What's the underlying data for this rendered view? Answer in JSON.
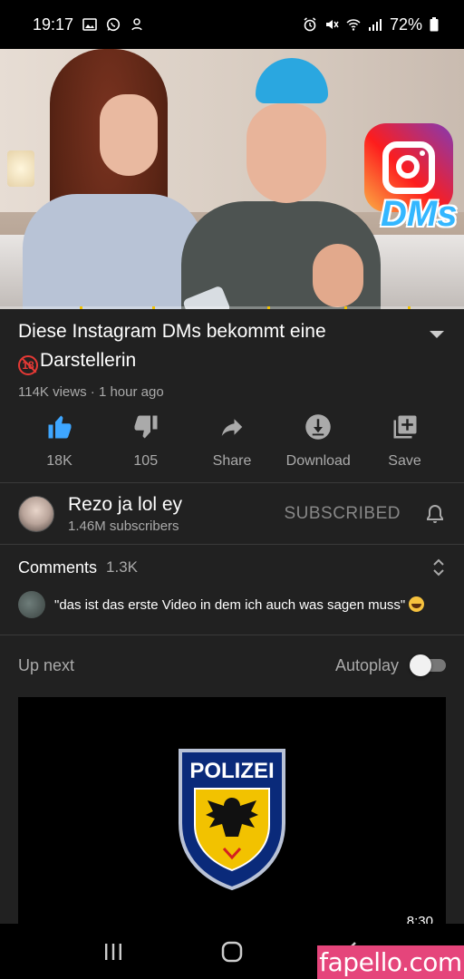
{
  "status_bar": {
    "time": "19:17",
    "battery": "72%",
    "left_icons": [
      "gallery-icon",
      "whatsapp-icon",
      "notification-icon"
    ],
    "right_icons": [
      "alarm-icon",
      "mute-icon",
      "wifi-icon",
      "signal-icon",
      "battery-icon"
    ]
  },
  "video": {
    "overlay_text": "DMs",
    "title_part1": "Diese Instagram DMs bekommt eine",
    "title_age_icon": "18",
    "title_part2": "Darstellerin",
    "views": "114K views",
    "separator": " · ",
    "age": "1 hour ago"
  },
  "actions": [
    {
      "name": "like",
      "label": "18K",
      "icon": "thumbs-up-icon",
      "active": true
    },
    {
      "name": "dislike",
      "label": "105",
      "icon": "thumbs-down-icon",
      "active": false
    },
    {
      "name": "share",
      "label": "Share",
      "icon": "share-icon",
      "active": false
    },
    {
      "name": "download",
      "label": "Download",
      "icon": "download-icon",
      "active": false
    },
    {
      "name": "save",
      "label": "Save",
      "icon": "playlist-add-icon",
      "active": false
    }
  ],
  "channel": {
    "name": "Rezo ja lol ey",
    "subscribers": "1.46M subscribers",
    "subscribe_state": "SUBSCRIBED"
  },
  "comments": {
    "label": "Comments",
    "count": "1.3K",
    "top_comment": "\"das ist das erste Video in dem ich auch was sagen muss\""
  },
  "up_next": {
    "label": "Up next",
    "autoplay_label": "Autoplay",
    "autoplay_on": false,
    "next_video": {
      "badge_text": "POLIZEI",
      "duration": "8:30"
    }
  },
  "watermark": "fapello.com",
  "colors": {
    "background": "#212121",
    "like_active": "#3ea6ff",
    "secondary_text": "#aaaaaa",
    "age_icon": "#e53935",
    "watermark_bg": "#e5457b"
  }
}
